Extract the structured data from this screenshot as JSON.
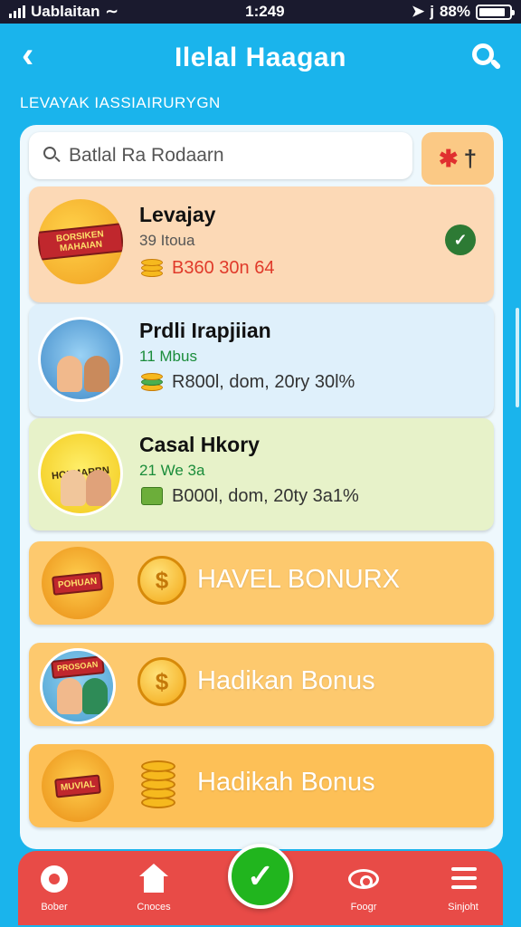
{
  "status_bar": {
    "carrier": "Uablaitan",
    "time": "1:249",
    "battery": "88%",
    "battery_level": 0.88
  },
  "header": {
    "title": "Ilelal Haagan",
    "back_icon": "chevron-left-icon",
    "search_icon": "search-icon"
  },
  "section_label": "LEVAYAK IASSIAIRURYGN",
  "search": {
    "placeholder": "Batlal Ra Rodaarn"
  },
  "filter_button": {
    "glyph_a": "✱",
    "glyph_b": "†"
  },
  "cards": [
    {
      "title": "Levajay",
      "subtitle": "39 Itoua",
      "meta": "B360 30n 64",
      "thumb_text": "BORSIKEN MAHAIAN",
      "badge": "✓"
    },
    {
      "title": "Prdli Irapjiian",
      "subtitle": "11 Mbus",
      "meta": "R800l, dom, 20ry 30l%",
      "thumb_text": ""
    },
    {
      "title": "Casal Hkory",
      "subtitle": "21 We 3a",
      "meta": "B000l, dom, 20ty 3a1%",
      "thumb_text": "HOLMARBN"
    }
  ],
  "bonus_cards": [
    {
      "label": "HAVEL BONURX",
      "thumb_text": "POHUAN",
      "coin": "$"
    },
    {
      "label": "Hadikan Bonus",
      "thumb_text": "PROSOAN",
      "coin": "$"
    },
    {
      "label": "Hadikah Bonus",
      "thumb_text": "MUVIAL",
      "coin": ""
    }
  ],
  "bottom_nav": {
    "items": [
      {
        "label": "Bober",
        "icon": "gear-icon"
      },
      {
        "label": "Cnoces",
        "icon": "home-icon"
      },
      {
        "label": "Foogr",
        "icon": "eye-icon"
      },
      {
        "label": "Sinjoht",
        "icon": "menu-icon"
      }
    ],
    "center_icon": "check-icon",
    "center_glyph": "✓"
  }
}
